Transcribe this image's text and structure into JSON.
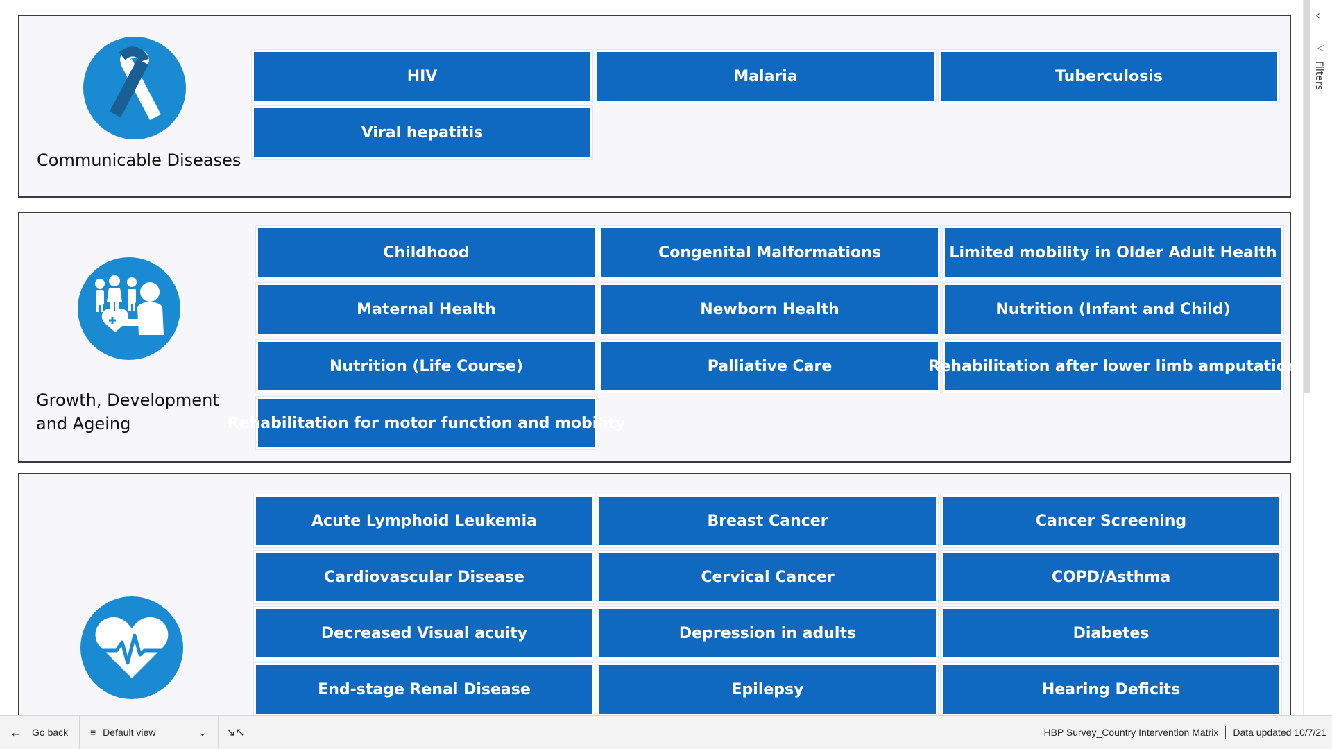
{
  "sections": [
    {
      "title": "Communicable Diseases",
      "tiles": [
        "HIV",
        "Malaria",
        "Tuberculosis",
        "Viral hepatitis"
      ]
    },
    {
      "title": "Growth, Development and Ageing",
      "tiles": [
        "Childhood",
        "Congenital Malformations",
        "Limited mobility in Older Adult Health",
        "Maternal Health",
        "Newborn Health",
        "Nutrition (Infant and Child)",
        "Nutrition (Life Course)",
        "Palliative Care",
        "Rehabilitation after lower limb amputation",
        "Rehabilitation for motor function and mobility"
      ]
    },
    {
      "title": "",
      "tiles": [
        "Acute Lymphoid Leukemia",
        "Breast Cancer",
        "Cancer Screening",
        "Cardiovascular Disease",
        "Cervical Cancer",
        "COPD/Asthma",
        "Decreased Visual acuity",
        "Depression in adults",
        "Diabetes",
        "End-stage Renal Disease",
        "Epilepsy",
        "Hearing Deficits"
      ]
    }
  ],
  "filters_pane": {
    "label": "Filters"
  },
  "statusbar": {
    "go_back": "Go back",
    "view": "Default view",
    "report_name": "HBP Survey_Country Intervention Matrix",
    "data_updated": "Data updated 10/7/21"
  },
  "colors": {
    "tile": "#0f69c1",
    "icon_circle": "#1a8bd3",
    "panel_bg": "#f6f6fb"
  },
  "icons": [
    "ribbon-icon",
    "family-care-icon",
    "heart-pulse-icon",
    "back-arrow-icon",
    "view-list-icon",
    "chevron-down-icon",
    "collapse-icon",
    "chevron-left-icon",
    "filter-icon"
  ]
}
